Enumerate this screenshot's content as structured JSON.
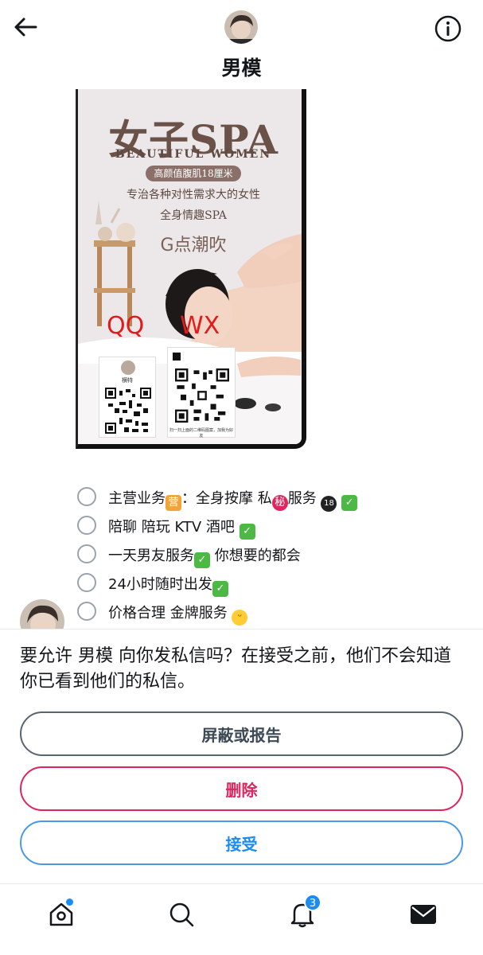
{
  "header": {
    "title": "男模",
    "back_icon": "arrow-left-icon",
    "info_icon": "info-circle-icon"
  },
  "poster": {
    "title": "女子SPA",
    "subtitle": "BEAUTIFUL WOMEN",
    "pill": "高颜值腹肌18厘米",
    "line1": "专治各种对性需求大的女性",
    "line2": "全身情趣SPA",
    "line3": "G点潮吹",
    "qq_label": "QQ",
    "wx_label": "WX",
    "qq_name": "横特",
    "qr_caption": "扫一扫上面的二维码图案，加我为好友"
  },
  "message_options": [
    {
      "text": "主营业务",
      "rest": "：全身按摩 私",
      "rest2": "服务 "
    },
    {
      "text": "陪聊 陪玩  KTV 酒吧 "
    },
    {
      "text": "一天男友服务",
      "rest": "  你想要的都会"
    },
    {
      "text": "24小时随时出发"
    },
    {
      "text": "价格合理 金牌服务"
    }
  ],
  "emoji": {
    "check": "✓",
    "ying": "营",
    "mi": "秘",
    "eighteen": "18",
    "grin": "ᵕ"
  },
  "request": {
    "prompt": "要允许 男模 向你发私信吗？在接受之前，他们不会知道你已看到他们的私信。",
    "block_label": "屏蔽或报告",
    "delete_label": "删除",
    "accept_label": "接受"
  },
  "tabbar": {
    "notifications_badge": "3",
    "home_icon": "home-icon",
    "search_icon": "search-icon",
    "notifications_icon": "bell-icon",
    "messages_icon": "mail-icon"
  },
  "colors": {
    "accent": "#1d8cf0",
    "danger": "#e0245e",
    "text": "#14171a"
  }
}
